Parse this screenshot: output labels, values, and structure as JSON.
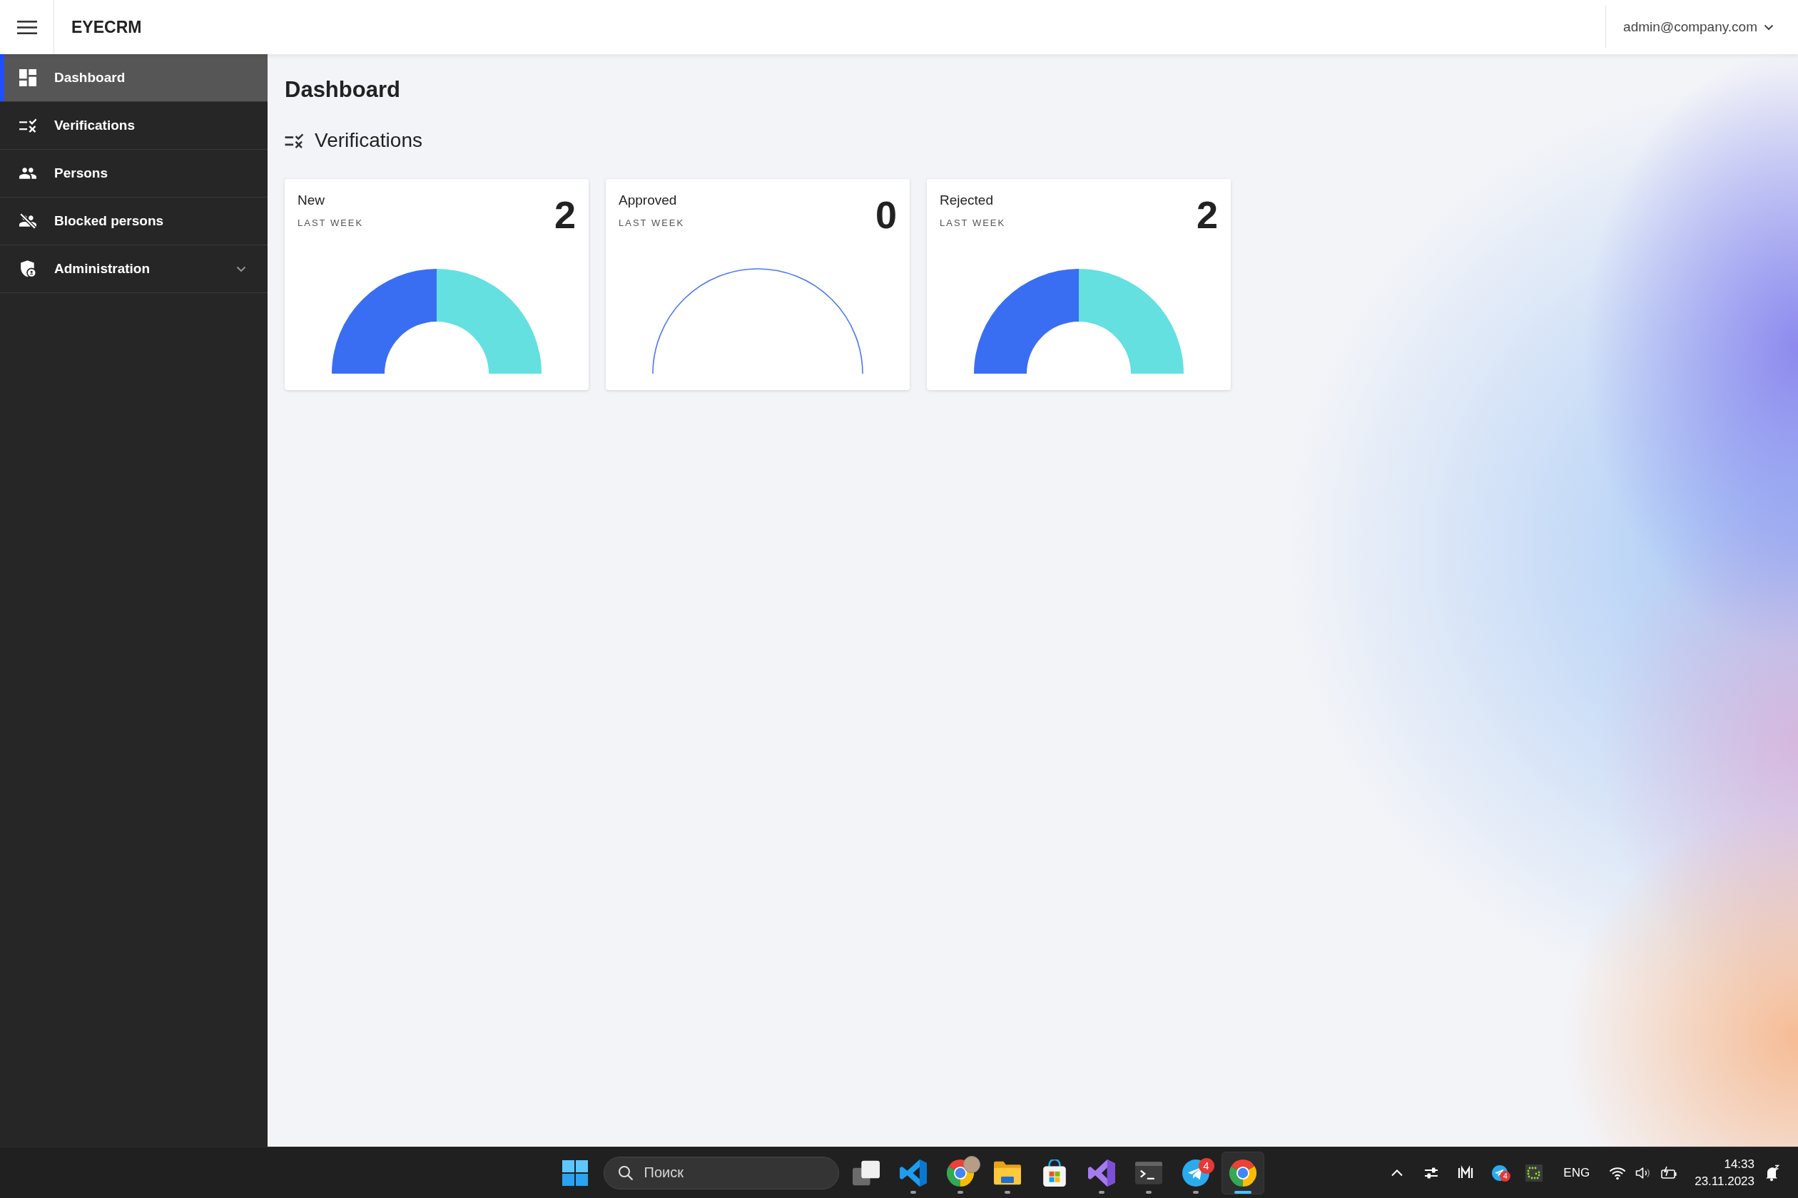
{
  "header": {
    "brand": "EYECRM",
    "user": "admin@company.com"
  },
  "sidebar": {
    "items": [
      {
        "label": "Dashboard",
        "kind": "link",
        "selected": true
      },
      {
        "label": "Verifications",
        "kind": "link",
        "selected": false
      },
      {
        "label": "Persons",
        "kind": "link",
        "selected": false
      },
      {
        "label": "Blocked persons",
        "kind": "link",
        "selected": false
      },
      {
        "label": "Administration",
        "kind": "group",
        "selected": false,
        "expanded": false
      }
    ]
  },
  "page": {
    "title": "Dashboard",
    "section": {
      "title": "Verifications",
      "cards": [
        {
          "label": "New",
          "period": "LAST WEEK",
          "count": "2",
          "kind": "split"
        },
        {
          "label": "Approved",
          "period": "LAST WEEK",
          "count": "0",
          "kind": "empty"
        },
        {
          "label": "Rejected",
          "period": "LAST WEEK",
          "count": "2",
          "kind": "split"
        }
      ]
    }
  },
  "taskbar": {
    "search": {
      "placeholder": "Поиск"
    },
    "apps": [
      {
        "kind": "taskview",
        "running": false,
        "selected": false
      },
      {
        "kind": "editor",
        "running": true,
        "selected": false
      },
      {
        "kind": "profilebrowser",
        "running": true,
        "selected": false
      },
      {
        "kind": "files",
        "running": true,
        "selected": false
      },
      {
        "kind": "store",
        "running": false,
        "selected": false
      },
      {
        "kind": "ide",
        "running": true,
        "selected": false
      },
      {
        "kind": "terminal",
        "running": true,
        "selected": false
      },
      {
        "kind": "messenger",
        "running": true,
        "selected": false,
        "badge": "4"
      },
      {
        "kind": "browser",
        "running": true,
        "selected": true
      }
    ],
    "tray": {
      "notification_count": "4",
      "language": "ENG",
      "time": "14:33",
      "date": "23.11.2023"
    }
  }
}
